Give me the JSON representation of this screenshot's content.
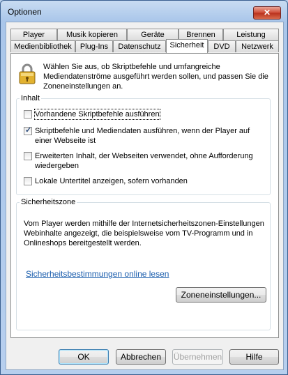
{
  "window": {
    "title": "Optionen",
    "close_label": "✕"
  },
  "tabs_row1": [
    "Player",
    "Musik kopieren",
    "Geräte",
    "Brennen",
    "Leistung"
  ],
  "tabs_row2": [
    "Medienbibliothek",
    "Plug-Ins",
    "Datenschutz",
    "Sicherheit",
    "DVD",
    "Netzwerk"
  ],
  "active_tab": "Sicherheit",
  "intro_text": "Wählen Sie aus, ob Skriptbefehle und umfangreiche Mediendatenströme ausgeführt werden sollen, und passen Sie die Zoneneinstellungen an.",
  "content_group": {
    "legend": "Inhalt",
    "options": [
      {
        "label": "Vorhandene Skriptbefehle ausführen",
        "checked": false
      },
      {
        "label": "Skriptbefehle und Mediendaten ausführen, wenn der Player auf einer Webseite ist",
        "checked": true
      },
      {
        "label": "Erweiterten Inhalt, der Webseiten verwendet, ohne Aufforderung wiedergeben",
        "checked": false
      },
      {
        "label": "Lokale Untertitel anzeigen, sofern vorhanden",
        "checked": false
      }
    ]
  },
  "zone_group": {
    "legend": "Sicherheitszone",
    "text": "Vom Player werden mithilfe der Internetsicherheitszonen-Einstellungen Webinhalte angezeigt, die beispielsweise vom TV-Programm und in Onlineshops bereitgestellt werden.",
    "link": "Sicherheitsbestimmungen online lesen",
    "zone_button": "Zoneneinstellungen..."
  },
  "buttons": {
    "ok": "OK",
    "cancel": "Abbrechen",
    "apply": "Übernehmen",
    "help": "Hilfe"
  }
}
